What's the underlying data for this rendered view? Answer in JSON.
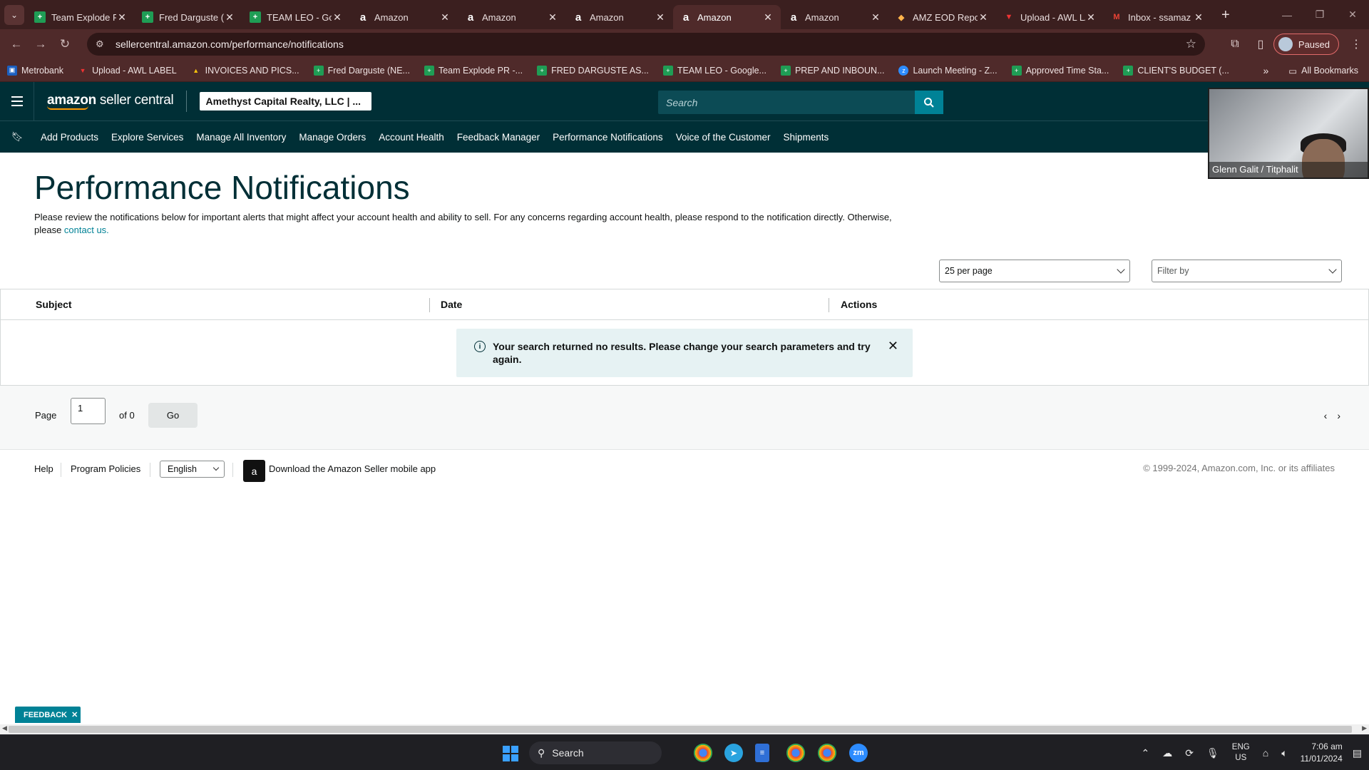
{
  "browser": {
    "tabs": [
      {
        "title": "Team Explode PR",
        "favicon": "sheets-icon"
      },
      {
        "title": "Fred Darguste (NE",
        "favicon": "sheets-icon"
      },
      {
        "title": "TEAM LEO - Google",
        "favicon": "sheets-icon"
      },
      {
        "title": "Amazon",
        "favicon": "amazon-icon"
      },
      {
        "title": "Amazon",
        "favicon": "amazon-icon"
      },
      {
        "title": "Amazon",
        "favicon": "amazon-icon"
      },
      {
        "title": "Amazon",
        "favicon": "amazon-icon",
        "active": true
      },
      {
        "title": "Amazon",
        "favicon": "amazon-icon"
      },
      {
        "title": "AMZ EOD Report",
        "favicon": "amz-icon"
      },
      {
        "title": "Upload - AWL LABEL",
        "favicon": "awl-icon"
      },
      {
        "title": "Inbox - ssamaz",
        "favicon": "gmail-icon"
      }
    ],
    "url": "sellercentral.amazon.com/performance/notifications",
    "profile_status": "Paused",
    "bookmarks": [
      {
        "label": "Metrobank",
        "icon": "bank-icon"
      },
      {
        "label": "Upload - AWL LABEL",
        "icon": "awl-icon"
      },
      {
        "label": "INVOICES AND PICS...",
        "icon": "drive-icon"
      },
      {
        "label": "Fred Darguste (NE...",
        "icon": "sheets-icon"
      },
      {
        "label": "Team Explode PR -...",
        "icon": "sheets-icon"
      },
      {
        "label": "FRED DARGUSTE AS...",
        "icon": "sheets-icon"
      },
      {
        "label": "TEAM LEO - Google...",
        "icon": "sheets-icon"
      },
      {
        "label": "PREP AND INBOUN...",
        "icon": "sheets-icon"
      },
      {
        "label": "Launch Meeting - Z...",
        "icon": "zoom-icon"
      },
      {
        "label": "Approved Time Sta...",
        "icon": "sheets-icon"
      },
      {
        "label": "CLIENT'S BUDGET (...",
        "icon": "sheets-icon"
      }
    ],
    "all_bookmarks": "All Bookmarks"
  },
  "header": {
    "logo_bold": "amazon",
    "logo_rest": " seller central",
    "account": "Amethyst Capital Realty, LLC | ...",
    "search_placeholder": "Search"
  },
  "nav": {
    "items": [
      "Add Products",
      "Explore Services",
      "Manage All Inventory",
      "Manage Orders",
      "Account Health",
      "Feedback Manager",
      "Performance Notifications",
      "Voice of the Customer",
      "Shipments"
    ]
  },
  "video": {
    "participant": "Glenn Galit / Titphalit"
  },
  "page": {
    "title": "Performance Notifications",
    "intro": "Please review the notifications below for important alerts that might affect your account health and ability to sell. For any concerns regarding account health, please respond to the notification directly. Otherwise, please ",
    "contact_link": "contact us.",
    "per_page": "25 per page",
    "filter_placeholder": "Filter by",
    "columns": [
      "Subject",
      "Date",
      "Actions"
    ],
    "empty_message": "Your search returned no results. Please change your search parameters and try again.",
    "pager": {
      "label": "Page",
      "current": "1",
      "of_label": "of 0",
      "go": "Go"
    }
  },
  "footer": {
    "help": "Help",
    "policies": "Program Policies",
    "language": "English",
    "download": "Download the Amazon Seller mobile app",
    "copyright": "© 1999-2024, Amazon.com, Inc. or its affiliates"
  },
  "feedback": "FEEDBACK",
  "taskbar": {
    "search": "Search",
    "lang_top": "ENG",
    "lang_bottom": "US",
    "time": "7:06 am",
    "date": "11/01/2024"
  }
}
